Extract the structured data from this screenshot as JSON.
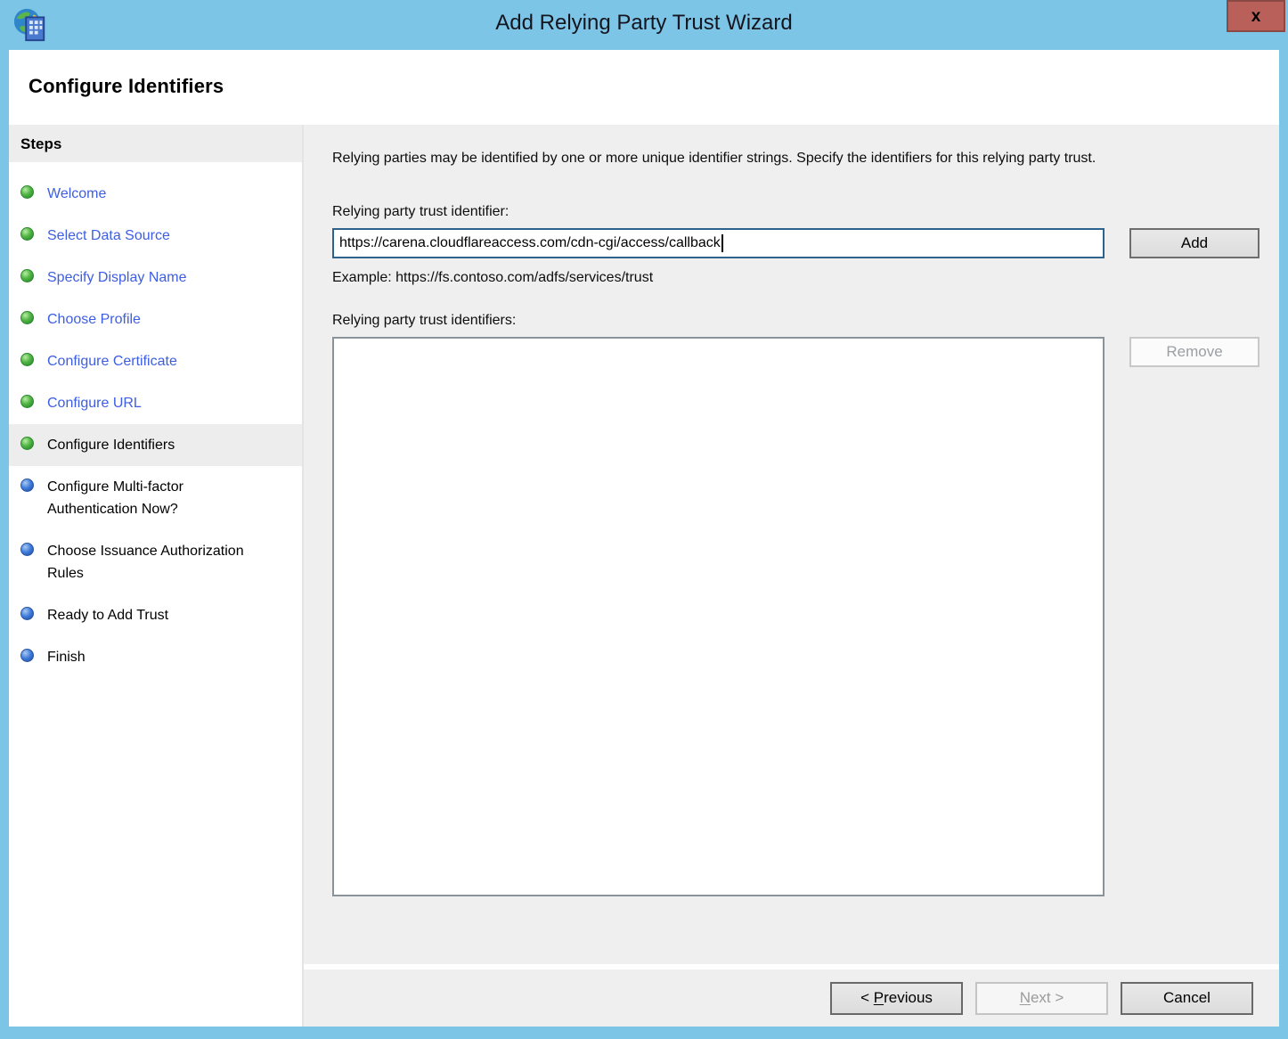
{
  "window": {
    "title": "Add Relying Party Trust Wizard",
    "close_label": "x"
  },
  "header": {
    "title": "Configure Identifiers"
  },
  "sidebar": {
    "title": "Steps",
    "items": [
      {
        "label": "Welcome",
        "state": "done"
      },
      {
        "label": "Select Data Source",
        "state": "done"
      },
      {
        "label": "Specify Display Name",
        "state": "done"
      },
      {
        "label": "Choose Profile",
        "state": "done"
      },
      {
        "label": "Configure Certificate",
        "state": "done"
      },
      {
        "label": "Configure URL",
        "state": "done"
      },
      {
        "label": "Configure Identifiers",
        "state": "current"
      },
      {
        "label": "Configure Multi-factor Authentication Now?",
        "state": "todo"
      },
      {
        "label": "Choose Issuance Authorization Rules",
        "state": "todo"
      },
      {
        "label": "Ready to Add Trust",
        "state": "todo"
      },
      {
        "label": "Finish",
        "state": "todo"
      }
    ]
  },
  "main": {
    "intro": "Relying parties may be identified by one or more unique identifier strings. Specify the identifiers for this relying party trust.",
    "identifier_label": "Relying party trust identifier:",
    "identifier_value": "https://carena.cloudflareaccess.com/cdn-cgi/access/callback",
    "add_button": "Add",
    "example": "Example: https://fs.contoso.com/adfs/services/trust",
    "identifiers_list_label": "Relying party trust identifiers:",
    "identifiers": [],
    "remove_button": "Remove"
  },
  "footer": {
    "previous_button": "< Previous",
    "previous_key": "P",
    "next_button": "Next >",
    "next_key": "N",
    "cancel_button": "Cancel"
  },
  "colors": {
    "titlebar": "#7dc5e6",
    "close_button": "#b9605a",
    "link_blue": "#3d5ee2",
    "done_bullet_green": "#52b545",
    "todo_bullet_blue": "#3c79d8",
    "content_background": "#efefef",
    "focused_input_border": "#2c628b"
  }
}
